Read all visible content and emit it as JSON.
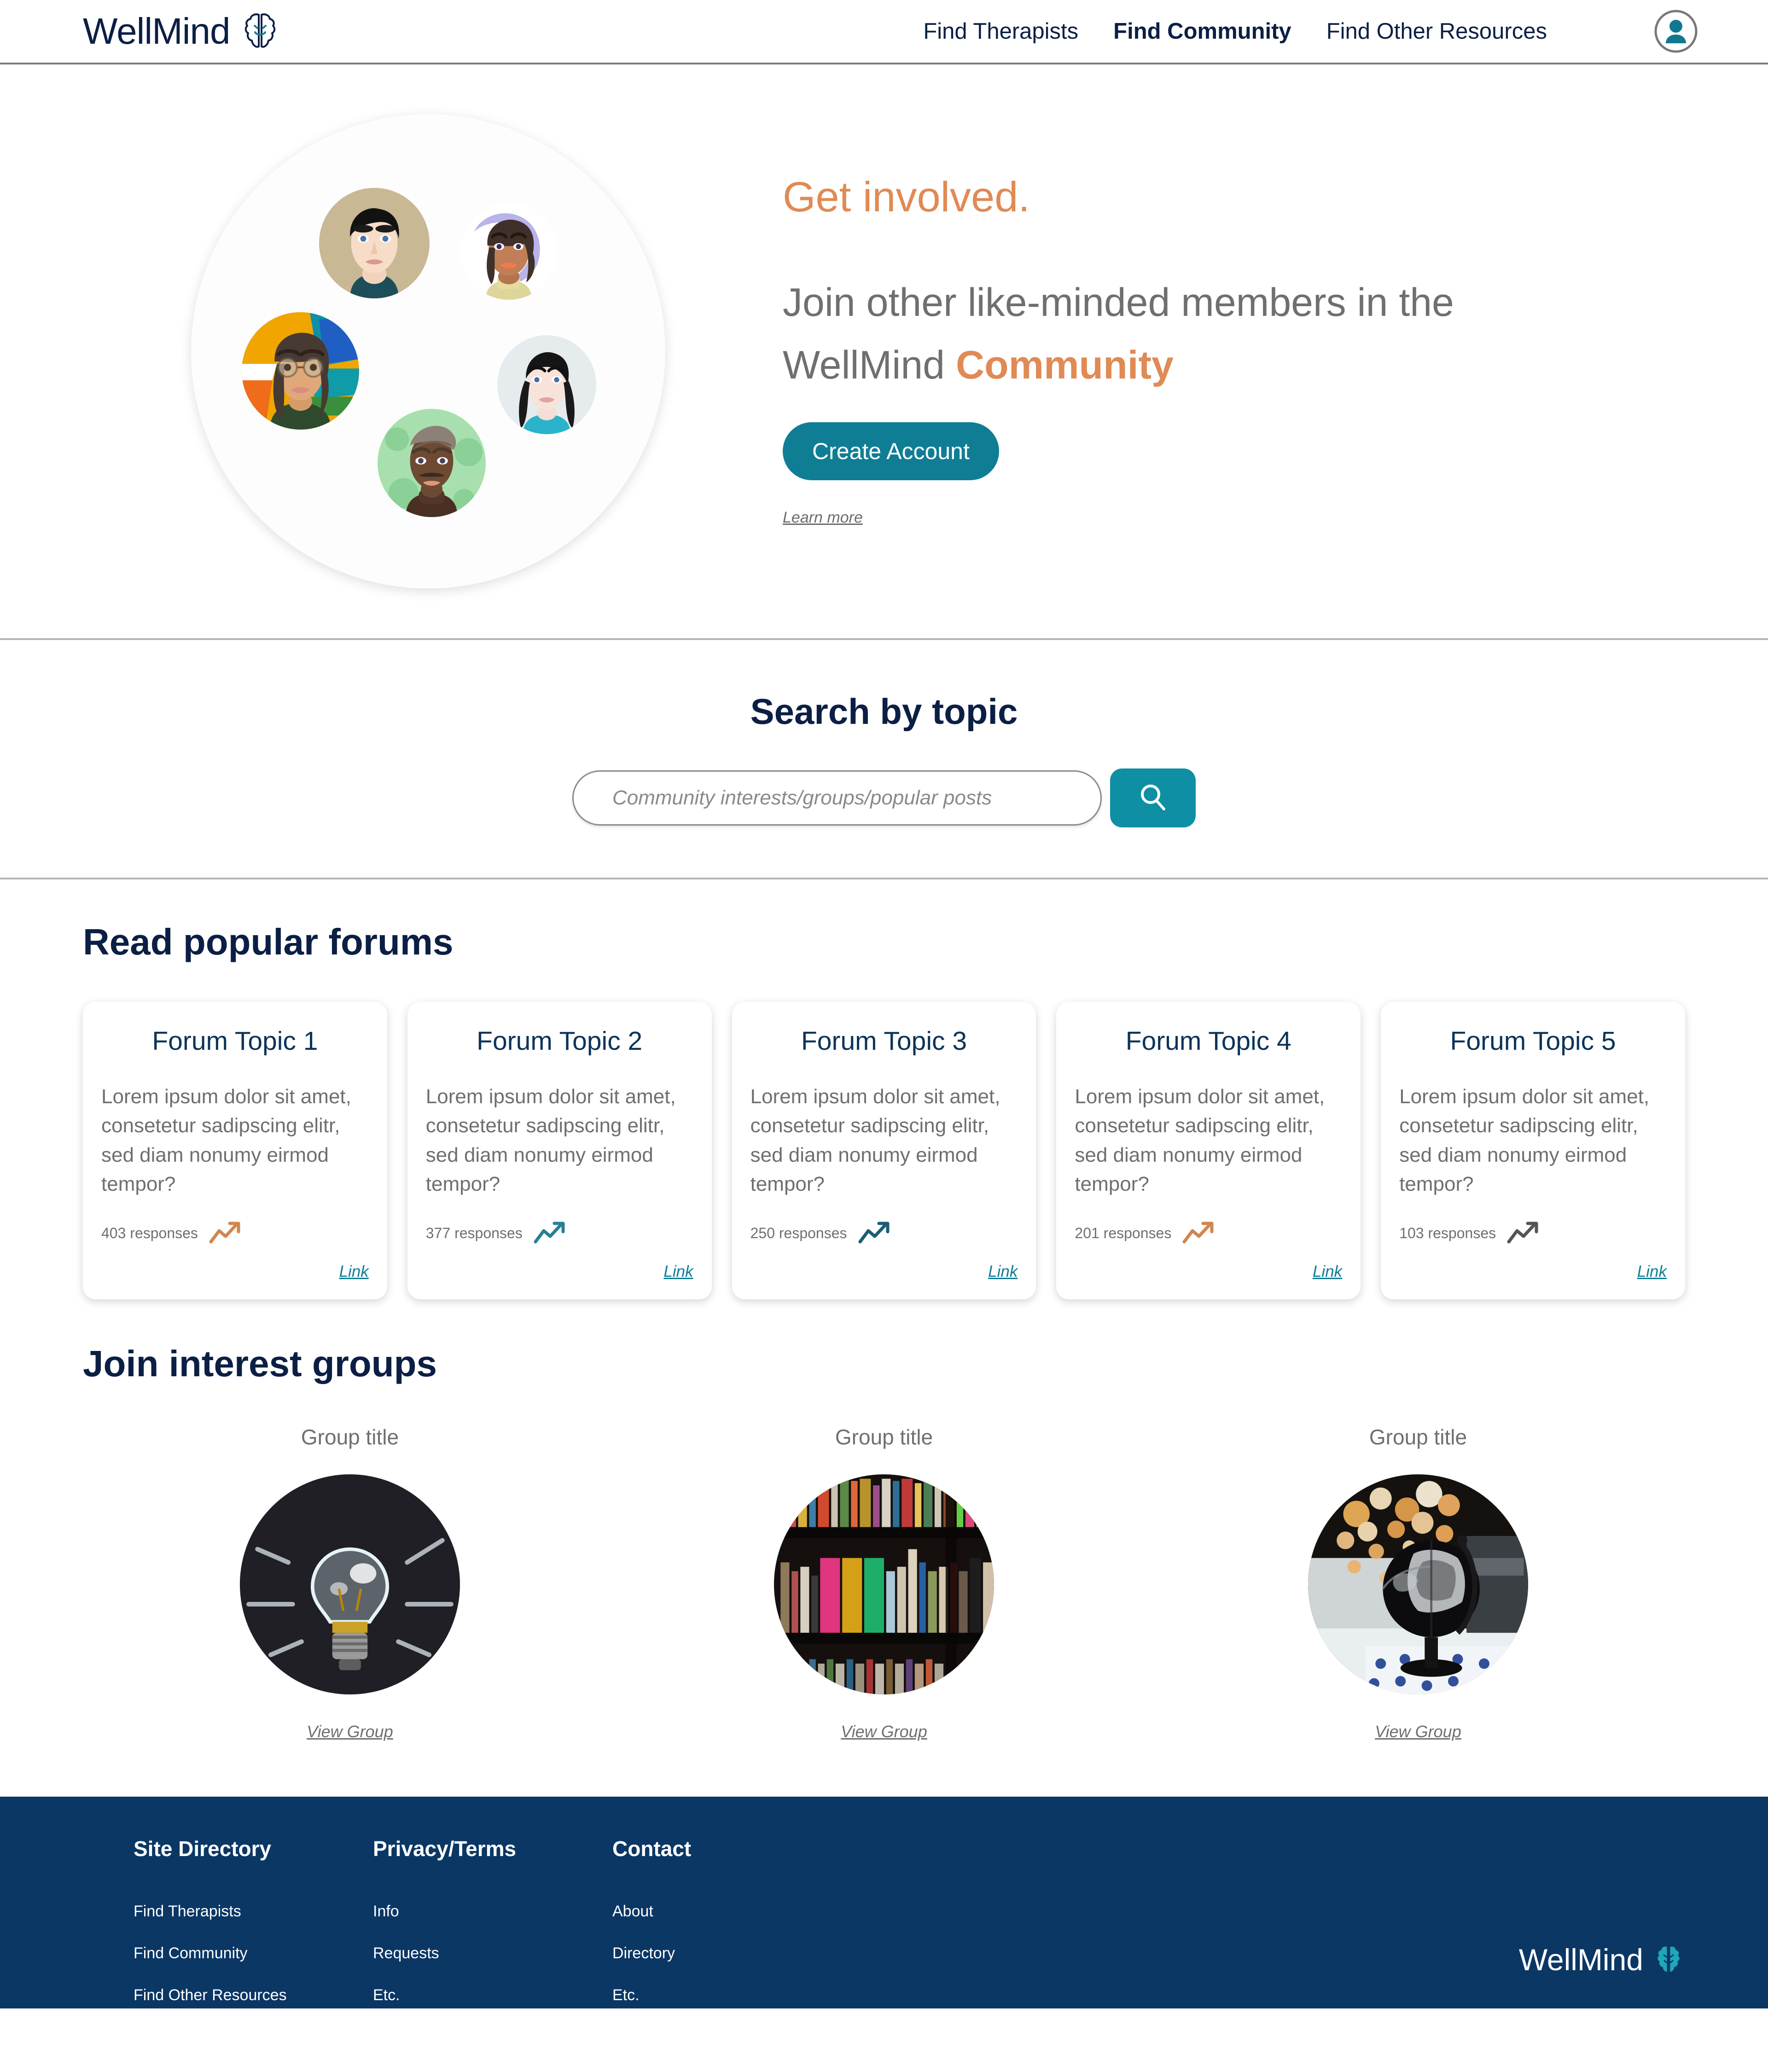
{
  "brand": {
    "name": "WellMind",
    "icon": "brain-icon"
  },
  "nav": {
    "items": [
      {
        "label": "Find Therapists",
        "active": false
      },
      {
        "label": "Find Community",
        "active": true
      },
      {
        "label": "Find Other Resources",
        "active": false
      }
    ],
    "account_icon": "account-avatar-icon"
  },
  "hero": {
    "eyebrow": "Get involved.",
    "headline_prefix": "Join other like-minded members in the WellMind ",
    "headline_accent": "Community",
    "cta_label": "Create Account",
    "learn_more_label": "Learn more"
  },
  "search": {
    "title": "Search by topic",
    "placeholder": "Community interests/groups/popular posts",
    "value": "",
    "button_icon": "search-icon"
  },
  "forums": {
    "title": "Read popular forums",
    "cards": [
      {
        "title": "Forum Topic 1",
        "body": "Lorem ipsum dolor sit amet, consetetur sadipscing elitr, sed diam nonumy eirmod tempor?",
        "responses": "403 responses",
        "trend_color": "#d2854f",
        "link_label": "Link"
      },
      {
        "title": "Forum Topic 2",
        "body": "Lorem ipsum dolor sit amet, consetetur sadipscing elitr, sed diam nonumy eirmod tempor?",
        "responses": "377 responses",
        "trend_color": "#2a7f96",
        "link_label": "Link"
      },
      {
        "title": "Forum Topic 3",
        "body": "Lorem ipsum dolor sit amet, consetetur sadipscing elitr, sed diam nonumy eirmod tempor?",
        "responses": "250 responses",
        "trend_color": "#1b5d74",
        "link_label": "Link"
      },
      {
        "title": "Forum Topic 4",
        "body": "Lorem ipsum dolor sit amet, consetetur sadipscing elitr, sed diam nonumy eirmod tempor?",
        "responses": "201 responses",
        "trend_color": "#d2854f",
        "link_label": "Link"
      },
      {
        "title": "Forum Topic 5",
        "body": "Lorem ipsum dolor sit amet, consetetur sadipscing elitr, sed diam nonumy eirmod tempor?",
        "responses": "103 responses",
        "trend_color": "#555555",
        "link_label": "Link"
      }
    ]
  },
  "groups": {
    "title": "Join interest groups",
    "items": [
      {
        "title": "Group title",
        "image": "lightbulb-chalkboard-photo",
        "link_label": "View Group"
      },
      {
        "title": "Group title",
        "image": "bookshelf-photo",
        "link_label": "View Group"
      },
      {
        "title": "Group title",
        "image": "globe-bokeh-photo",
        "link_label": "View Group"
      }
    ]
  },
  "footer": {
    "columns": [
      {
        "title": "Site Directory",
        "links": [
          "Find Therapists",
          "Find Community",
          "Find Other Resources"
        ]
      },
      {
        "title": "Privacy/Terms",
        "links": [
          "Info",
          "Requests",
          "Etc."
        ]
      },
      {
        "title": "Contact",
        "links": [
          "About",
          "Directory",
          "Etc."
        ]
      }
    ],
    "brand_name": "WellMind"
  },
  "colors": {
    "navy": "#0b1f45",
    "footer_navy": "#0b3765",
    "teal": "#0f7e95",
    "teal_bright": "#0e8fa4",
    "orange": "#e08a55",
    "gray_text": "#6f6f6f"
  }
}
